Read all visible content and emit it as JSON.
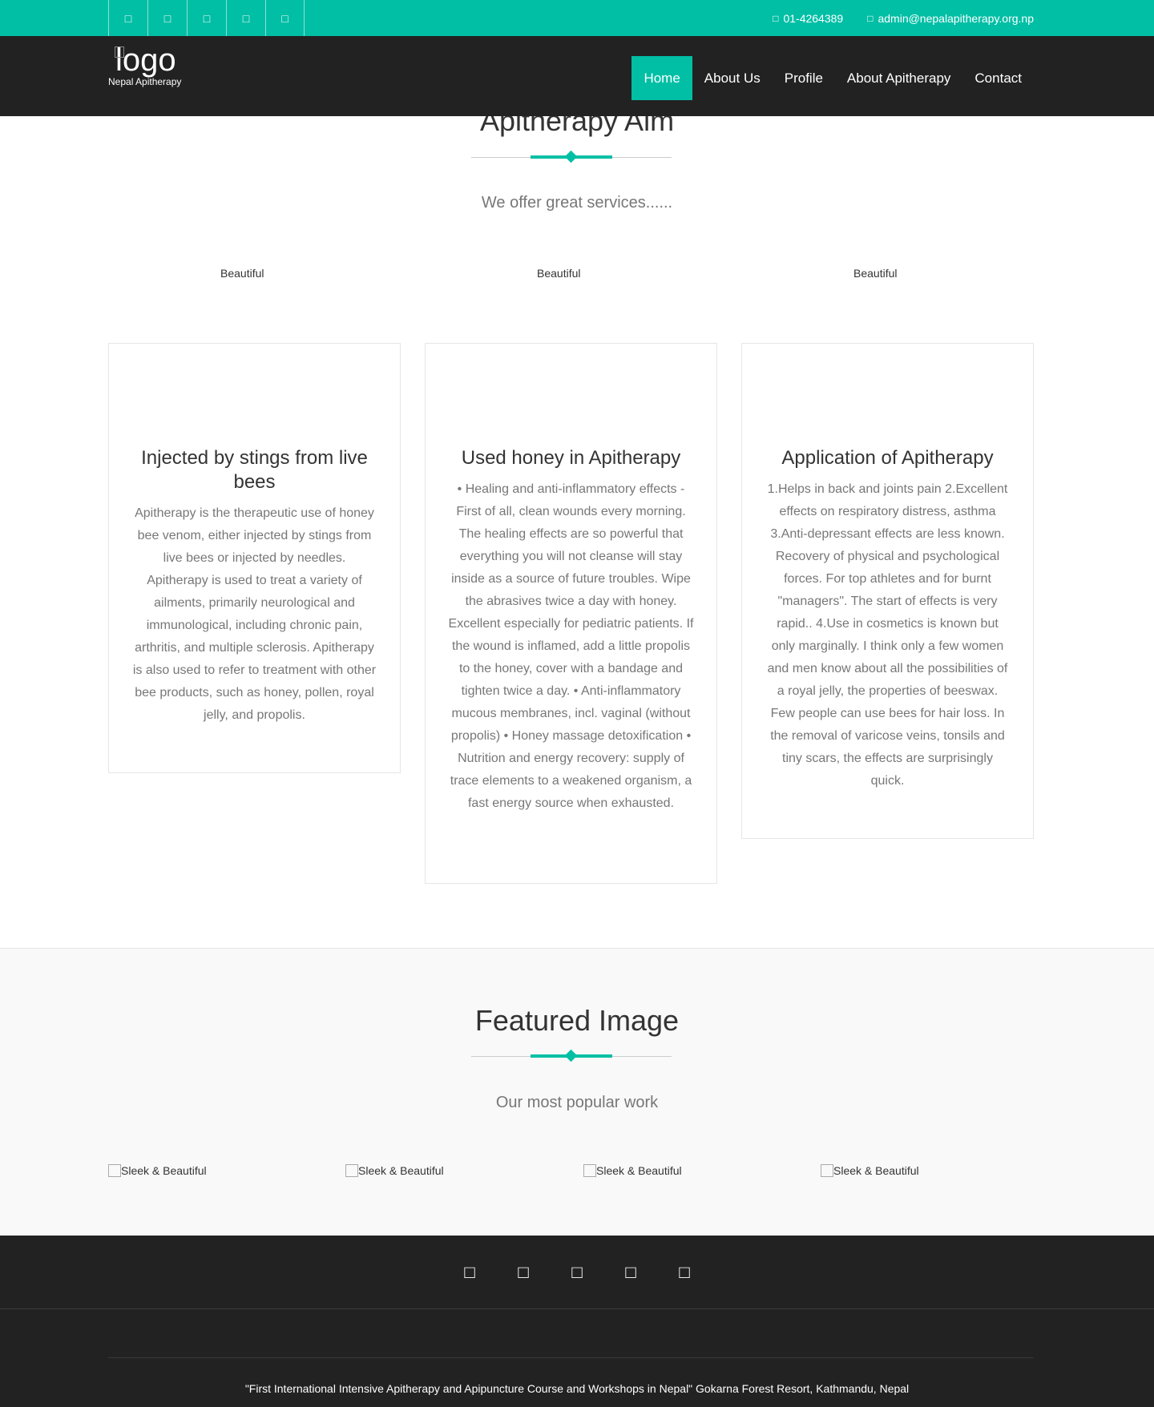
{
  "topbar": {
    "social_icons": [
      "facebook-icon",
      "twitter-icon",
      "google-plus-icon",
      "linkedin-icon",
      "youtube-icon"
    ],
    "phone": "01-4264389",
    "email": "admin@nepalapitherapy.org.np"
  },
  "header": {
    "logo_alt": "logo",
    "site_name": "Nepal Apitherapy",
    "nav": [
      "Home",
      "About Us",
      "Profile",
      "About Apitherapy",
      "Contact"
    ]
  },
  "aim": {
    "title": "Apitherapy Aim",
    "subtitle": "We offer great services......",
    "image_alt": "Beautiful"
  },
  "cards": [
    {
      "title": "Injected by stings from live bees",
      "body": "Apitherapy is the therapeutic use of honey bee venom, either injected by stings from live bees or injected by needles. Apitherapy is used to treat a variety of ailments, primarily neurological and immunological, including chronic pain, arthritis, and multiple sclerosis. Apitherapy is also used to refer to treatment with other bee products, such as honey, pollen, royal jelly, and propolis."
    },
    {
      "title": "Used honey in Apitherapy",
      "body": "• Healing and anti-inflammatory effects - First of all, clean wounds every morning. The healing effects are so powerful that everything you will not cleanse will stay inside as a source of future troubles. Wipe the abrasives twice a day with honey. Excellent especially for pediatric patients. If the wound is inflamed, add a little propolis to the honey, cover with a bandage and tighten twice a day. • Anti-inflammatory mucous membranes, incl. vaginal (without propolis) • Honey massage detoxification • Nutrition and energy recovery: supply of trace elements to a weakened organism, a fast energy source when exhausted."
    },
    {
      "title": "Application of Apitherapy",
      "body": "1.Helps in back and joints pain 2.Excellent effects on respiratory distress, asthma 3.Anti-depressant effects are less known. Recovery of physical and psychological forces. For top athletes and for burnt \"managers\". The start of effects is very rapid.. 4.Use in cosmetics is known but only marginally. I think only a few women and men know about all the possibilities of a royal jelly, the properties of beeswax. Few people can use bees for hair loss. In the removal of varicose veins, tonsils and tiny scars, the effects are surprisingly quick."
    }
  ],
  "featured": {
    "title": "Featured Image",
    "subtitle": "Our most popular work",
    "items": [
      "Sleek & Beautiful",
      "Sleek & Beautiful",
      "Sleek & Beautiful",
      "Sleek & Beautiful"
    ]
  },
  "footer": {
    "social_icons": [
      "facebook-icon",
      "twitter-icon",
      "google-plus-icon",
      "linkedin-icon",
      "youtube-icon"
    ],
    "text": "\"First International Intensive Apitherapy and Apipuncture Course and Workshops in Nepal\" Gokarna Forest Resort, Kathmandu, Nepal"
  },
  "colors": {
    "accent": "#00bfa5",
    "dark": "#222222"
  }
}
